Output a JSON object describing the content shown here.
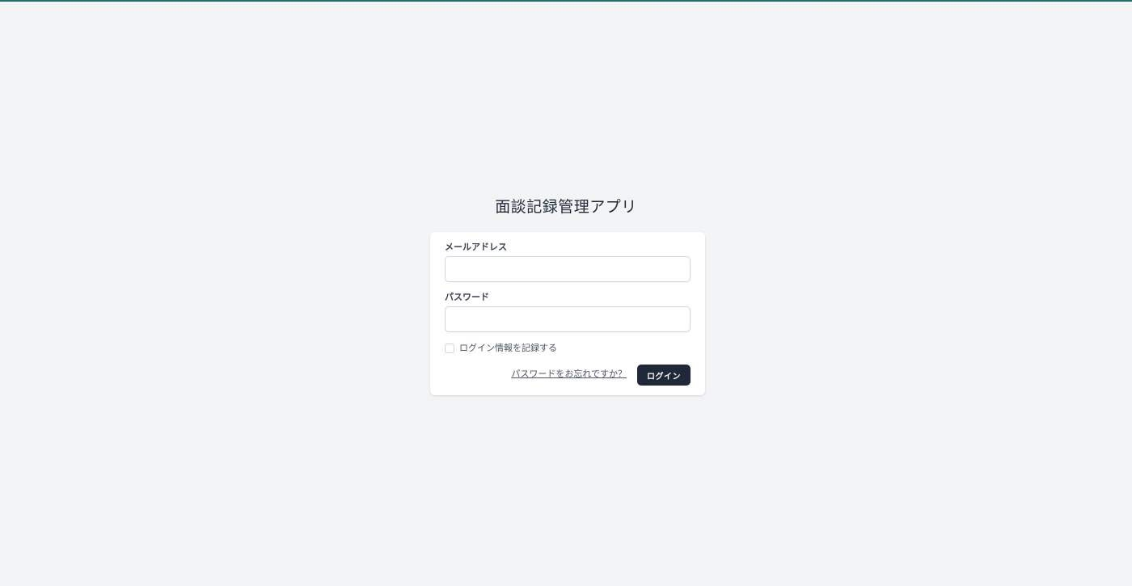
{
  "app": {
    "title": "面談記録管理アプリ"
  },
  "login_form": {
    "email_label": "メールアドレス",
    "email_value": "",
    "password_label": "パスワード",
    "password_value": "",
    "remember_label": "ログイン情報を記録する",
    "remember_checked": false,
    "forgot_link": "パスワードをお忘れですか？",
    "submit_label": "ログイン"
  },
  "colors": {
    "background": "#f3f4f6",
    "card": "#ffffff",
    "accent_bar": "#1f6f66",
    "button": "#1f2937"
  }
}
